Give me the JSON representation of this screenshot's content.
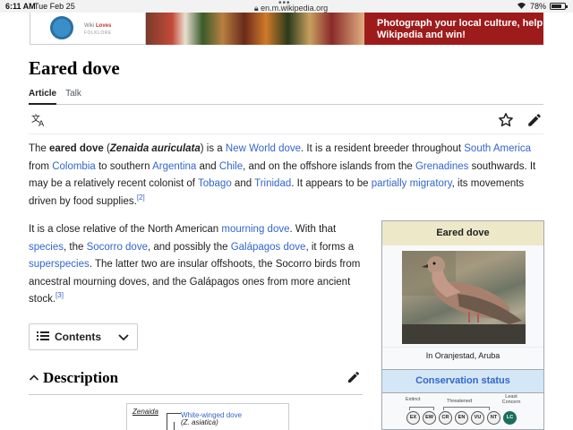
{
  "status_bar": {
    "time": "6:11 AM",
    "date": "Tue Feb 25",
    "url": "en.m.wikipedia.org",
    "battery": "78%",
    "battery_level": 0.78
  },
  "banner": {
    "logo_line1": "Wiki",
    "logo_line2": "Loves",
    "logo_line3": "FOLKLORE",
    "promo_line1": "Photograph your local culture, help",
    "promo_line2": "Wikipedia and win!"
  },
  "article": {
    "title": "Eared dove",
    "tabs": [
      {
        "label": "Article",
        "active": true
      },
      {
        "label": "Talk",
        "active": false
      }
    ],
    "p1": {
      "t1": "The ",
      "b1": "eared dove",
      "t2": " (",
      "i1": "Zenaida auriculata",
      "t3": ") is a ",
      "l1": "New World dove",
      "t4": ". It is a resident breeder throughout ",
      "l2": "South America",
      "t5": " from ",
      "l3": "Colombia",
      "t6": " to southern ",
      "l4": "Argentina",
      "t7": " and ",
      "l5": "Chile",
      "t8": ", and on the offshore islands from the ",
      "l6": "Grenadines",
      "t9": " southwards. It may be a relatively recent colonist of ",
      "l7": "Tobago",
      "t10": " and ",
      "l8": "Trinidad",
      "t11": ". It appears to be ",
      "l9": "partially migratory",
      "t12": ", its movements driven by food supplies.",
      "ref": "[2]"
    },
    "p2": {
      "t1": "It is a close relative of the North American ",
      "l1": "mourning dove",
      "t2": ". With that ",
      "l2": "species",
      "t3": ", the ",
      "l3": "Socorro dove",
      "t4": ", and possibly the ",
      "l4": "Galápagos dove",
      "t5": ", it forms a ",
      "l5": "superspecies",
      "t6": ". The latter two are insular offshoots, the Socorro birds from ancestral mourning doves, and the Galápagos ones from more ancient stock.",
      "ref": "[3]"
    },
    "contents_label": "Contents",
    "section_heading": "Description",
    "cladogram": {
      "genus": "Zenaida",
      "species1": "White-winged dove",
      "species2": "(Z. asiatica)"
    }
  },
  "infobox": {
    "title": "Eared dove",
    "caption": "In Oranjestad, Aruba",
    "conservation_header": "Conservation status",
    "group_extinct": "Extinct",
    "group_threatened": "Threatened",
    "group_least_concern": "Least Concern",
    "statuses": [
      "EX",
      "EW",
      "CR",
      "EN",
      "VU",
      "NT",
      "LC"
    ],
    "current_status": "LC",
    "current_status_color": "#1a6e5c"
  },
  "colors": {
    "link": "#3366cc",
    "promo_bg": "#9e1b1b",
    "infobox_title_bg": "#ede8c8",
    "conservation_bg": "#d4e7f7"
  }
}
